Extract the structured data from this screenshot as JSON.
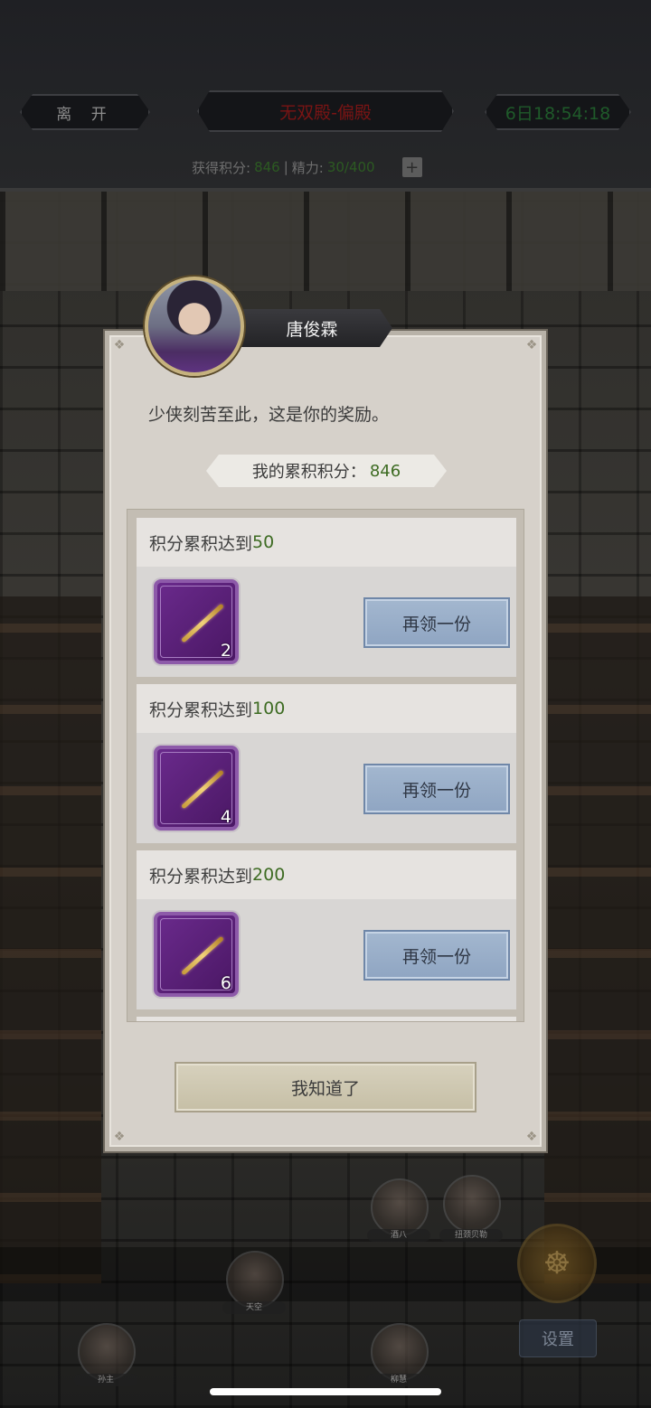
{
  "header": {
    "leave_label": "离 开",
    "title": "无双殿-偏殿",
    "timer": "6日18:54:18",
    "points_label": "获得积分:",
    "points_value": "846",
    "separator": "|",
    "energy_label": "精力:",
    "energy_value": "30/400",
    "plus": "+"
  },
  "characters": [
    {
      "name": "酒八"
    },
    {
      "name": "扭颈贝勒"
    },
    {
      "name": "天空"
    },
    {
      "name": "孙主"
    },
    {
      "name": "柳慧"
    }
  ],
  "meditate_icon": "meditate-icon",
  "settings_label": "设置",
  "dialog": {
    "npc_name": "唐俊霖",
    "message": "少侠刻苦至此，这是你的奖励。",
    "total_label": "我的累积积分：",
    "total_value": "846",
    "rewards": [
      {
        "prefix": "积分累积达到",
        "threshold": "50",
        "item_icon": "needle-icon",
        "count": "2",
        "button": "再领一份"
      },
      {
        "prefix": "积分累积达到",
        "threshold": "100",
        "item_icon": "needle-icon",
        "count": "4",
        "button": "再领一份"
      },
      {
        "prefix": "积分累积达到",
        "threshold": "200",
        "item_icon": "needle-icon",
        "count": "6",
        "button": "再领一份"
      }
    ],
    "ok_label": "我知道了"
  },
  "colors": {
    "accent_green": "#3d6b22",
    "item_purple": "#6a2a8c",
    "claim_blue": "#97abc7",
    "title_red": "#7a1414"
  }
}
